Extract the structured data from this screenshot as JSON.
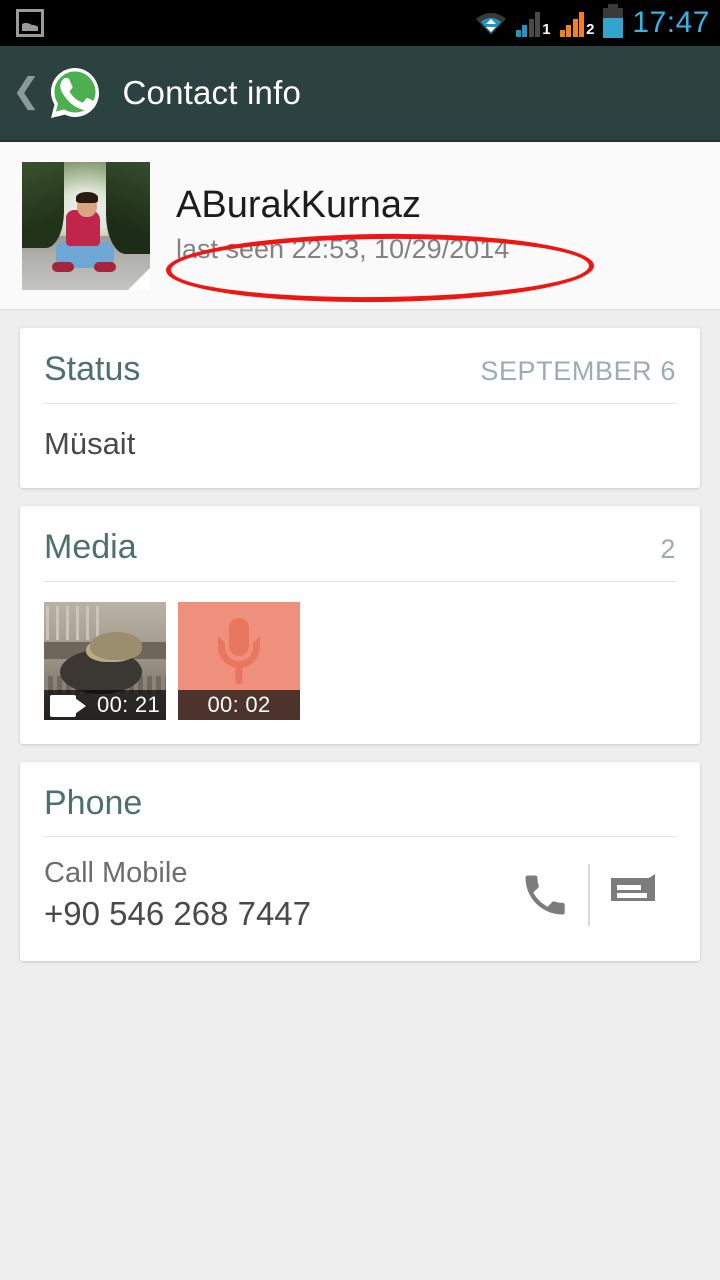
{
  "statusbar": {
    "notification_icon": "gallery-icon",
    "wifi_icon": "wifi-icon",
    "sim1_label": "1",
    "sim2_label": "2",
    "battery_icon": "battery-icon",
    "time": "17:47"
  },
  "appbar": {
    "back_icon": "back-chevron-icon",
    "app_icon": "whatsapp-logo-icon",
    "title": "Contact info"
  },
  "contact": {
    "avatar_alt": "contact-avatar",
    "name": "ABurakKurnaz",
    "last_seen": "last seen 22:53, 10/29/2014",
    "annotation": {
      "shape": "ellipse",
      "color": "#ee1512",
      "target": "last seen 22:53, 10/29/2014"
    }
  },
  "status_card": {
    "title": "Status",
    "date": "SEPTEMBER 6",
    "text": "Müsait"
  },
  "media_card": {
    "title": "Media",
    "count": "2",
    "items": [
      {
        "type": "video",
        "icon": "video-camera-icon",
        "duration": "00: 21"
      },
      {
        "type": "audio",
        "icon": "microphone-icon",
        "duration": "00: 02"
      }
    ]
  },
  "phone_card": {
    "title": "Phone",
    "label": "Call Mobile",
    "number": "+90 546 268 7447",
    "call_icon": "phone-handset-icon",
    "message_icon": "message-bubble-icon"
  },
  "colors": {
    "appbar": "#2c4241",
    "accent_teal": "#4e706e",
    "page_bg": "#eeeeee",
    "card_bg": "#ffffff",
    "annotation_red": "#ee1512",
    "clock_blue": "#33b5e5",
    "audio_thumb": "#ef907c"
  }
}
